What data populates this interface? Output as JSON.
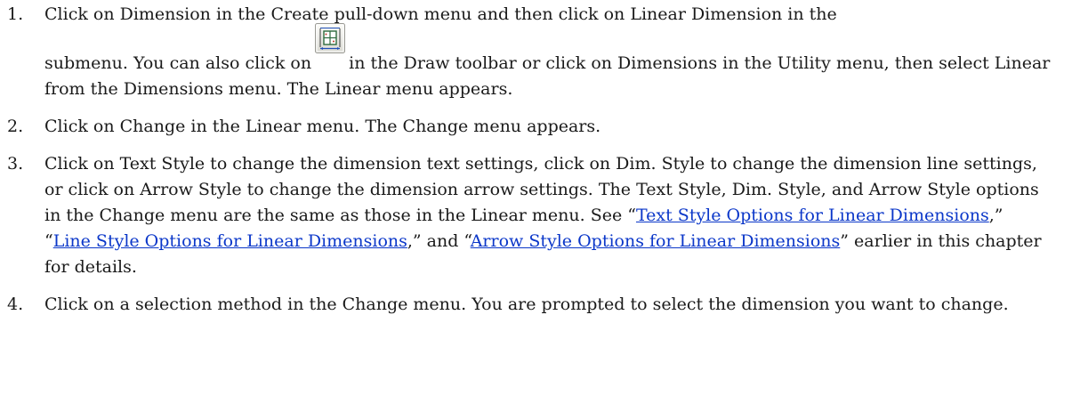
{
  "steps": [
    {
      "number": "1.",
      "line1": "Click on Dimension in the Create pull-down menu and then click on Linear Dimension in the",
      "before_icon": "submenu. You can also click on",
      "icon": "linear-dimension-icon",
      "after_icon": "in the Draw toolbar or click on Dimensions in the Utility menu, then select Linear from the Dimensions menu. The Linear menu appears."
    },
    {
      "number": "2.",
      "text": "Click on Change in the Linear menu. The Change menu appears."
    },
    {
      "number": "3.",
      "intro": "Click on Text Style to change the dimension text settings, click on Dim. Style to change the dimension line settings, or click on Arrow Style to change the dimension arrow settings. The Text Style, Dim. Style, and Arrow Style options in the Change menu are the same as those in the Linear menu. See “",
      "link1": "Text Style Options for Linear Dimensions",
      "sep1": ",” “",
      "link2": "Line Style Options for Linear Dimensions",
      "sep2": ",” and “",
      "link3": "Arrow Style Options for Linear Dimensions",
      "outro": "” earlier in this chapter for details."
    },
    {
      "number": "4.",
      "text": "Click on a selection method in the Change menu. You are prompted to select the dimension you want to change."
    }
  ],
  "colors": {
    "text": "#1a1a1a",
    "link": "#0b37c9"
  }
}
